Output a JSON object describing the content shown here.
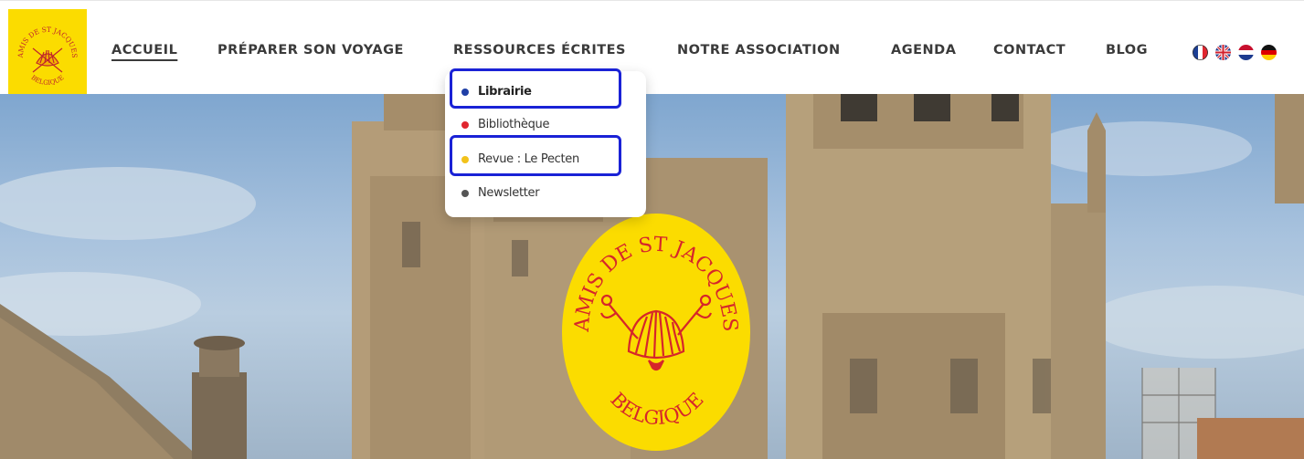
{
  "logo": {
    "small_top_text": "AMIS DE ST JACQUES",
    "small_bottom_text": "BELGIQUE"
  },
  "nav": {
    "items": [
      {
        "label": "ACCUEIL",
        "active": true
      },
      {
        "label": "PRÉPARER SON VOYAGE"
      },
      {
        "label": "RESSOURCES ÉCRITES"
      },
      {
        "label": "NOTRE ASSOCIATION"
      },
      {
        "label": "AGENDA"
      },
      {
        "label": "CONTACT"
      },
      {
        "label": "BLOG"
      }
    ]
  },
  "languages": [
    "fr-flag-icon",
    "uk-flag-icon",
    "nl-flag-icon",
    "de-flag-icon"
  ],
  "dropdown": {
    "items": [
      {
        "label": "Librairie",
        "dot_color": "#1f3fa6"
      },
      {
        "label": "Bibliothèque",
        "dot_color": "#e0262f"
      },
      {
        "label": "Revue : Le Pecten",
        "dot_color": "#f2c21b"
      },
      {
        "label": "Newsletter",
        "dot_color": "#555555"
      }
    ]
  },
  "badge": {
    "top_text": "AMIS DE ST JACQUES",
    "bottom_text": "BELGIQUE"
  },
  "colors": {
    "brand_yellow": "#fbdc00",
    "emblem_red": "#d6262a",
    "highlight_blue": "#1a22d6",
    "nav_text": "#3a3a3a"
  }
}
